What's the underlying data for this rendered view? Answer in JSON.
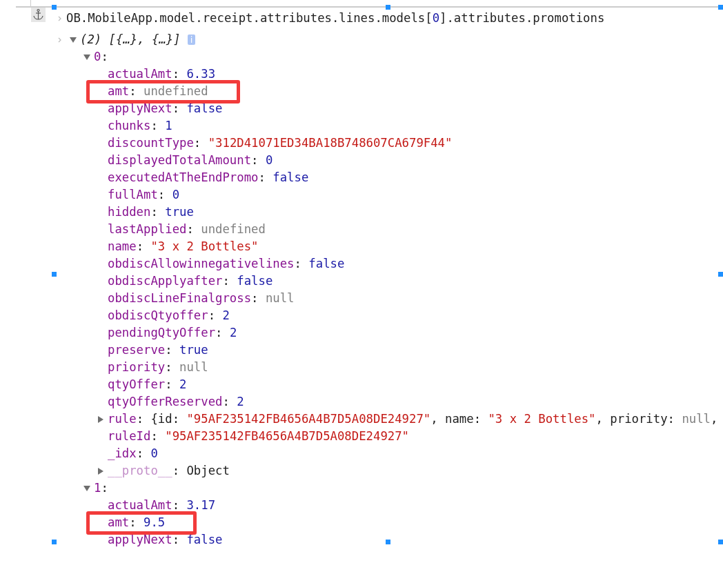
{
  "console": {
    "expression": [
      {
        "text": "OB.MobileApp.model.receipt.attributes.lines.models[",
        "kind": "plain"
      },
      {
        "text": "0",
        "kind": "number"
      },
      {
        "text": "].attributes.promotions",
        "kind": "plain"
      }
    ],
    "result": {
      "summary": "(2) [{…}, {…}]",
      "info_badge": "i",
      "expanded": true,
      "items": [
        {
          "key": "0",
          "punct": ":",
          "expanded": true,
          "properties": [
            {
              "key": "actualAmt",
              "value": [
                {
                  "text": ": ",
                  "kind": "plain"
                },
                {
                  "text": "6.33",
                  "kind": "number"
                }
              ],
              "highlighted": false,
              "internal": false
            },
            {
              "key": "amt",
              "value": [
                {
                  "text": ": ",
                  "kind": "plain"
                },
                {
                  "text": "undefined",
                  "kind": "undefined"
                }
              ],
              "highlighted": true,
              "internal": false
            },
            {
              "key": "applyNext",
              "value": [
                {
                  "text": ": ",
                  "kind": "plain"
                },
                {
                  "text": "false",
                  "kind": "boolean"
                }
              ],
              "highlighted": false,
              "internal": false
            },
            {
              "key": "chunks",
              "value": [
                {
                  "text": ": ",
                  "kind": "plain"
                },
                {
                  "text": "1",
                  "kind": "number"
                }
              ],
              "highlighted": false,
              "internal": false
            },
            {
              "key": "discountType",
              "value": [
                {
                  "text": ": ",
                  "kind": "plain"
                },
                {
                  "text": "\"312D41071ED34BA18B748607CA679F44\"",
                  "kind": "string"
                }
              ],
              "highlighted": false,
              "internal": false
            },
            {
              "key": "displayedTotalAmount",
              "value": [
                {
                  "text": ": ",
                  "kind": "plain"
                },
                {
                  "text": "0",
                  "kind": "number"
                }
              ],
              "highlighted": false,
              "internal": false
            },
            {
              "key": "executedAtTheEndPromo",
              "value": [
                {
                  "text": ": ",
                  "kind": "plain"
                },
                {
                  "text": "false",
                  "kind": "boolean"
                }
              ],
              "highlighted": false,
              "internal": false
            },
            {
              "key": "fullAmt",
              "value": [
                {
                  "text": ": ",
                  "kind": "plain"
                },
                {
                  "text": "0",
                  "kind": "number"
                }
              ],
              "highlighted": false,
              "internal": false
            },
            {
              "key": "hidden",
              "value": [
                {
                  "text": ": ",
                  "kind": "plain"
                },
                {
                  "text": "true",
                  "kind": "boolean"
                }
              ],
              "highlighted": false,
              "internal": false
            },
            {
              "key": "lastApplied",
              "value": [
                {
                  "text": ": ",
                  "kind": "plain"
                },
                {
                  "text": "undefined",
                  "kind": "undefined"
                }
              ],
              "highlighted": false,
              "internal": false
            },
            {
              "key": "name",
              "value": [
                {
                  "text": ": ",
                  "kind": "plain"
                },
                {
                  "text": "\"3 x 2 Bottles\"",
                  "kind": "string"
                }
              ],
              "highlighted": false,
              "internal": false
            },
            {
              "key": "obdiscAllowinnegativelines",
              "value": [
                {
                  "text": ": ",
                  "kind": "plain"
                },
                {
                  "text": "false",
                  "kind": "boolean"
                }
              ],
              "highlighted": false,
              "internal": false
            },
            {
              "key": "obdiscApplyafter",
              "value": [
                {
                  "text": ": ",
                  "kind": "plain"
                },
                {
                  "text": "false",
                  "kind": "boolean"
                }
              ],
              "highlighted": false,
              "internal": false
            },
            {
              "key": "obdiscLineFinalgross",
              "value": [
                {
                  "text": ": ",
                  "kind": "plain"
                },
                {
                  "text": "null",
                  "kind": "null"
                }
              ],
              "highlighted": false,
              "internal": false
            },
            {
              "key": "obdiscQtyoffer",
              "value": [
                {
                  "text": ": ",
                  "kind": "plain"
                },
                {
                  "text": "2",
                  "kind": "number"
                }
              ],
              "highlighted": false,
              "internal": false
            },
            {
              "key": "pendingQtyOffer",
              "value": [
                {
                  "text": ": ",
                  "kind": "plain"
                },
                {
                  "text": "2",
                  "kind": "number"
                }
              ],
              "highlighted": false,
              "internal": false
            },
            {
              "key": "preserve",
              "value": [
                {
                  "text": ": ",
                  "kind": "plain"
                },
                {
                  "text": "true",
                  "kind": "boolean"
                }
              ],
              "highlighted": false,
              "internal": false
            },
            {
              "key": "priority",
              "value": [
                {
                  "text": ": ",
                  "kind": "plain"
                },
                {
                  "text": "null",
                  "kind": "null"
                }
              ],
              "highlighted": false,
              "internal": false
            },
            {
              "key": "qtyOffer",
              "value": [
                {
                  "text": ": ",
                  "kind": "plain"
                },
                {
                  "text": "2",
                  "kind": "number"
                }
              ],
              "highlighted": false,
              "internal": false
            },
            {
              "key": "qtyOfferReserved",
              "value": [
                {
                  "text": ": ",
                  "kind": "plain"
                },
                {
                  "text": "2",
                  "kind": "number"
                }
              ],
              "highlighted": false,
              "internal": false
            },
            {
              "key": "rule",
              "expanded": false,
              "value": [
                {
                  "text": ": {id: ",
                  "kind": "plain"
                },
                {
                  "text": "\"95AF235142FB4656A4B7D5A08DE24927\"",
                  "kind": "string"
                },
                {
                  "text": ", name: ",
                  "kind": "plain"
                },
                {
                  "text": "\"3 x 2 Bottles\"",
                  "kind": "string"
                },
                {
                  "text": ", priority: ",
                  "kind": "plain"
                },
                {
                  "text": "null",
                  "kind": "null"
                },
                {
                  "text": ",",
                  "kind": "plain"
                }
              ],
              "highlighted": false,
              "internal": false
            },
            {
              "key": "ruleId",
              "value": [
                {
                  "text": ": ",
                  "kind": "plain"
                },
                {
                  "text": "\"95AF235142FB4656A4B7D5A08DE24927\"",
                  "kind": "string"
                }
              ],
              "highlighted": false,
              "internal": false
            },
            {
              "key": "_idx",
              "value": [
                {
                  "text": ": ",
                  "kind": "plain"
                },
                {
                  "text": "0",
                  "kind": "number"
                }
              ],
              "highlighted": false,
              "internal": false
            },
            {
              "key": "__proto__",
              "expanded": false,
              "value": [
                {
                  "text": ": ",
                  "kind": "plain"
                },
                {
                  "text": "Object",
                  "kind": "plain"
                }
              ],
              "highlighted": false,
              "internal": true
            }
          ]
        },
        {
          "key": "1",
          "punct": ":",
          "expanded": true,
          "properties": [
            {
              "key": "actualAmt",
              "value": [
                {
                  "text": ": ",
                  "kind": "plain"
                },
                {
                  "text": "3.17",
                  "kind": "number"
                }
              ],
              "highlighted": false,
              "internal": false
            },
            {
              "key": "amt",
              "value": [
                {
                  "text": ": ",
                  "kind": "plain"
                },
                {
                  "text": "9.5",
                  "kind": "number"
                }
              ],
              "highlighted": true,
              "internal": false
            },
            {
              "key": "applyNext",
              "value": [
                {
                  "text": ": ",
                  "kind": "plain"
                },
                {
                  "text": "false",
                  "kind": "boolean"
                }
              ],
              "highlighted": false,
              "internal": false
            }
          ]
        }
      ]
    }
  }
}
